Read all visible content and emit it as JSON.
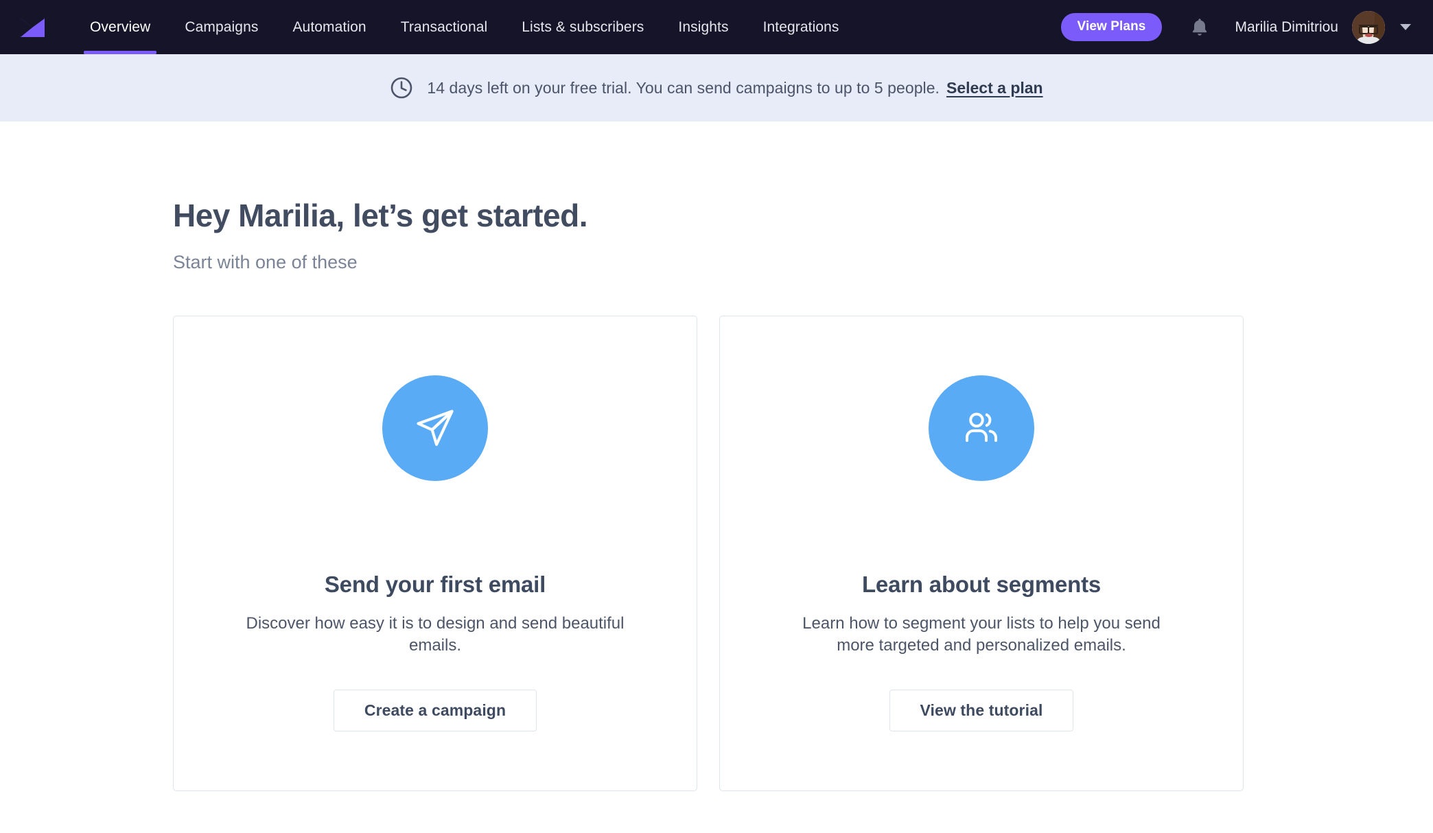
{
  "nav": {
    "logo_icon": "moosend-envelope-logo",
    "tabs": [
      {
        "label": "Overview",
        "active": true
      },
      {
        "label": "Campaigns",
        "active": false
      },
      {
        "label": "Automation",
        "active": false
      },
      {
        "label": "Transactional",
        "active": false
      },
      {
        "label": "Lists & subscribers",
        "active": false
      },
      {
        "label": "Insights",
        "active": false
      },
      {
        "label": "Integrations",
        "active": false
      }
    ],
    "view_plans_label": "View Plans",
    "notifications_icon": "bell-icon",
    "user_name": "Marilia Dimitriou",
    "avatar_icon": "user-avatar",
    "account_menu_icon": "chevron-down-icon"
  },
  "banner": {
    "icon": "clock-icon",
    "text": "14 days left on your free trial. You can send campaigns to up to 5 people.",
    "link_label": "Select a plan"
  },
  "main": {
    "title": "Hey Marilia, let’s get started.",
    "subtitle": "Start with one of these",
    "cards": [
      {
        "icon": "send-paper-plane-icon",
        "title": "Send your first email",
        "description": "Discover how easy it is to design and send beautiful emails.",
        "button_label": "Create a campaign"
      },
      {
        "icon": "users-segment-icon",
        "title": "Learn about segments",
        "description": "Learn how to segment your lists to help you send more targeted and personalized emails.",
        "button_label": "View the tutorial"
      }
    ]
  },
  "colors": {
    "nav_background": "#151428",
    "accent_purple": "#7b5cfa",
    "banner_background": "#e8ebf8",
    "card_icon_blue": "#5aabf5",
    "text_dark": "#3e4a5f",
    "border_light": "#dfe3ec"
  }
}
